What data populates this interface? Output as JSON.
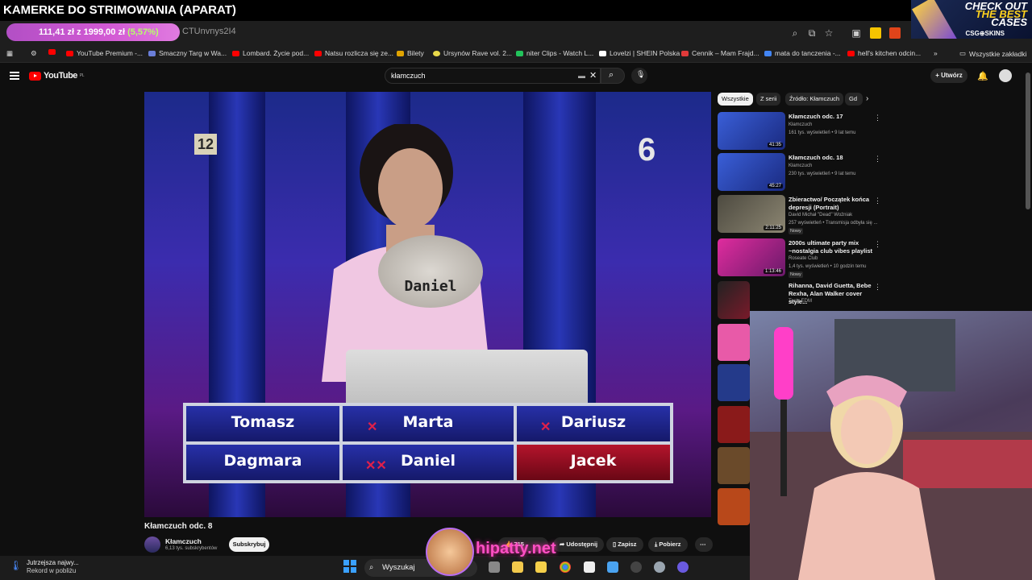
{
  "stream_overlay": {
    "title": "KAMERKE DO STRIMOWANIA (APARAT)",
    "donation_text": "111,41 zł z 1999,00 zł",
    "donation_pct": "(5,57%)",
    "donation_progress": 0.0557,
    "watermark": "hipatty.net",
    "ad": {
      "line1": "CHECK OUT",
      "line2": "THE BEST",
      "line3": "CASES",
      "brand": "CSG⊕SKINS"
    }
  },
  "browser": {
    "url_fragment": "CTUnvnys2I4",
    "bookmarks": [
      "YouTube Premium -...",
      "Smaczny Targ w Wa...",
      "Lombard. Życie pod...",
      "Natsu rozlicza się ze...",
      "Bilety",
      "Ursynów Rave vol. 2...",
      "niter Clips - Watch L...",
      "Lovelzi | SHEIN Polska",
      "Cennik – Mam Frajd...",
      "mata do tanczenia -...",
      "hell's kitchen odcin..."
    ],
    "all_bookmarks": "Wszystkie zakładki"
  },
  "youtube": {
    "logo": "YouTube",
    "region": "PL",
    "search_query": "kłamczuch",
    "create_label": "Utwórz",
    "video": {
      "title": "Kłamczuch odc. 8",
      "channel": "Kłamczuch",
      "subscribers": "6,13 tys. subskrybentów",
      "subscribe_label": "Subskrybuj",
      "likes": "715",
      "share_label": "Udostępnij",
      "save_label": "Zapisz",
      "download_label": "Pobierz",
      "screen": {
        "channel_left": "12",
        "channel_right": "6",
        "plate_name": "Daniel",
        "board_row1": [
          "Tomasz",
          "Marta",
          "Dariusz"
        ],
        "board_row2": [
          "Dagmara",
          "Daniel",
          "Jacek"
        ]
      }
    },
    "chips": [
      "Wszystkie",
      "Z serii",
      "Źródło: Kłamczuch",
      "Gd"
    ],
    "recommendations": [
      {
        "title": "Kłamczuch odc. 17",
        "channel": "Kłamczuch",
        "meta": "161 tys. wyświetleń • 9 lat temu",
        "duration": "41:35",
        "badge": ""
      },
      {
        "title": "Kłamczuch odc. 18",
        "channel": "Kłamczuch",
        "meta": "230 tys. wyświetleń • 9 lat temu",
        "duration": "45:27",
        "badge": ""
      },
      {
        "title": "Zbieractwo/ Początek końca depresji (Portrait)",
        "channel": "David Michał \"Dead\" Woźniak",
        "meta": "257 wyświetleń • Transmisja odbyła się ...",
        "duration": "2:11:25",
        "badge": "Nowy"
      },
      {
        "title": "2000s ultimate party mix ~nostalgia club vibes playlist",
        "channel": "Roseate Club",
        "meta": "1,4 tys. wyświetleń • 10 godzin temu",
        "duration": "1:13:46",
        "badge": "Nowy"
      },
      {
        "title": "Rihanna, David Guetta, Bebe Rexha, Alan Walker cover style...",
        "channel": "Tasty EDM",
        "meta": "",
        "duration": "",
        "badge": ""
      }
    ]
  },
  "taskbar": {
    "weather_line1": "Jutrzejsza najwy...",
    "weather_line2": "Rekord w pobliżu",
    "search_label": "Wyszukaj"
  },
  "colors": {
    "yt_red": "#ff0000",
    "bg": "#0f0f0f",
    "board_blue": "#1f2690",
    "board_red": "#a3102a"
  }
}
